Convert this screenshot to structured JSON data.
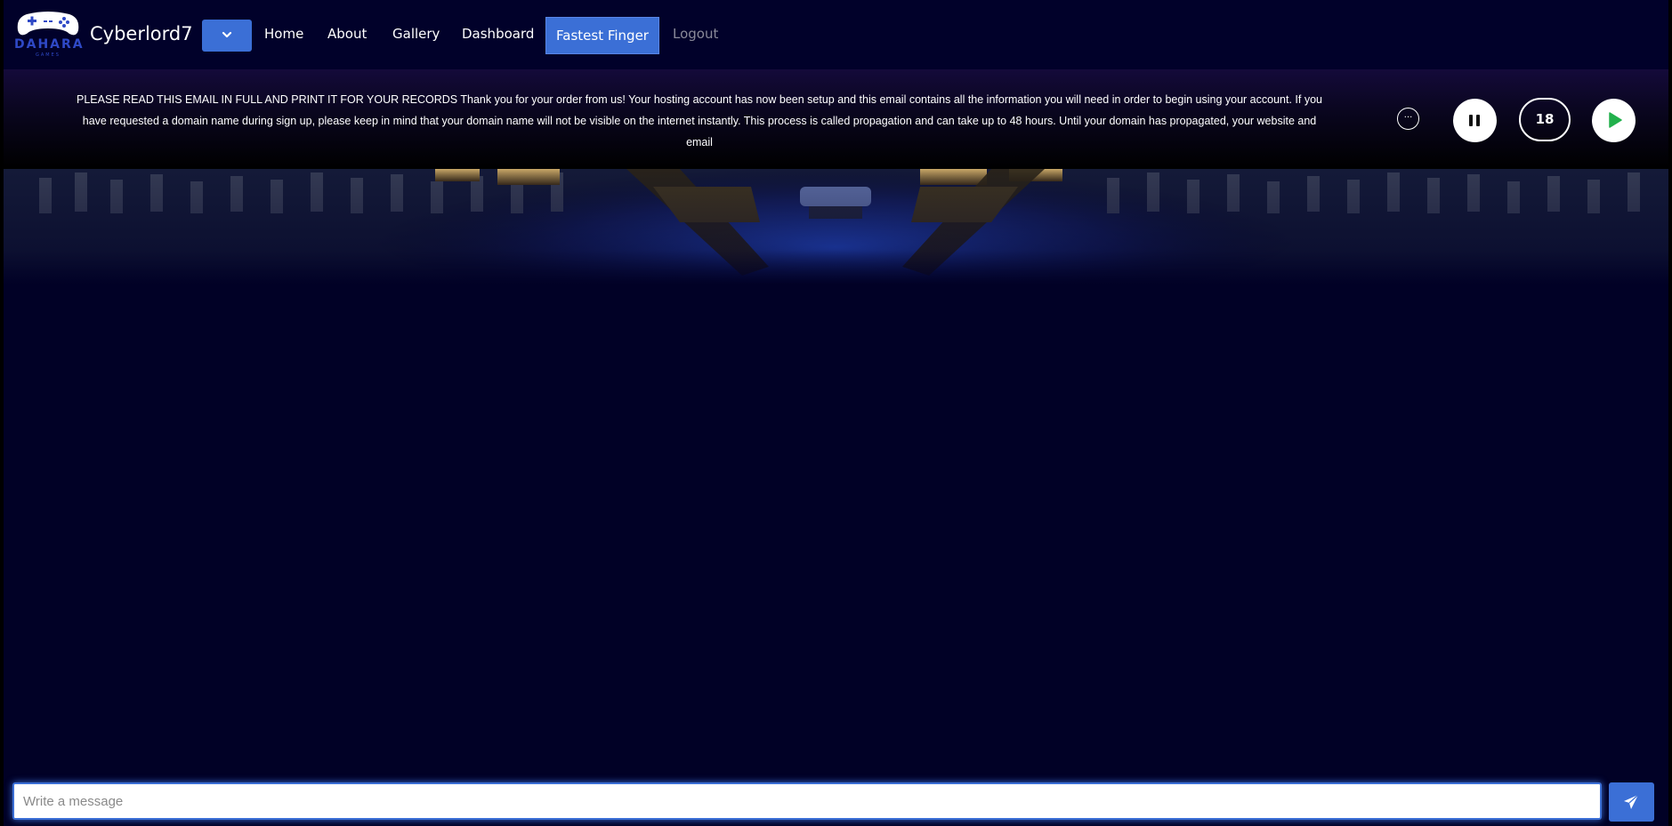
{
  "header": {
    "logo_text": "DAHARA",
    "logo_subtext": "GAMES",
    "username": "Cyberlord7"
  },
  "nav": {
    "home": "Home",
    "about": "About",
    "gallery": "Gallery",
    "dashboard": "Dashboard",
    "fastest_finger": "Fastest Finger",
    "logout": "Logout"
  },
  "banner": {
    "message": "PLEASE READ THIS EMAIL IN FULL AND PRINT IT FOR YOUR RECORDS Thank you for your order from us! Your hosting account has now been setup and this email contains all the information you will need in order to begin using your account. If you have requested a domain name during sign up, please keep in mind that your domain name will not be visible on the internet instantly. This process is called propagation and can take up to 48 hours. Until your domain has propagated, your website and email",
    "more_label": "···",
    "counter": "18"
  },
  "chat": {
    "placeholder": "Write a message"
  },
  "icons": {
    "logo": "gamepad-icon",
    "dropdown": "chevron-down-icon",
    "pause": "pause-icon",
    "play": "play-icon",
    "send": "send-icon"
  },
  "colors": {
    "background": "#010126",
    "accent": "#3b6fd6",
    "play_green": "#22b14c"
  }
}
